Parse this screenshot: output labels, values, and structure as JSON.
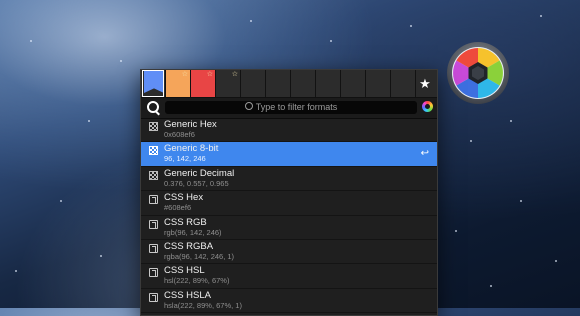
{
  "toolbar": {
    "swatches": [
      {
        "color": "#608ef6",
        "selected": true,
        "starred": false
      },
      {
        "color": "#f5a55a",
        "selected": false,
        "starred": true
      },
      {
        "color": "#e84545",
        "selected": false,
        "starred": true
      },
      {
        "color": "#2c2c2c",
        "selected": false,
        "starred": true
      },
      {
        "color": "#2c2c2c",
        "selected": false,
        "starred": false
      },
      {
        "color": "#2c2c2c",
        "selected": false,
        "starred": false
      },
      {
        "color": "#2c2c2c",
        "selected": false,
        "starred": false
      },
      {
        "color": "#2c2c2c",
        "selected": false,
        "starred": false
      },
      {
        "color": "#2c2c2c",
        "selected": false,
        "starred": false
      },
      {
        "color": "#2c2c2c",
        "selected": false,
        "starred": false
      },
      {
        "color": "#2c2c2c",
        "selected": false,
        "starred": false
      }
    ],
    "favorite_icon": "star-icon",
    "favorite_glyph": "★"
  },
  "search": {
    "placeholder": "Type to filter formats",
    "left_icon": "loupe-icon",
    "right_icon": "color-wheel-icon"
  },
  "formats": [
    {
      "name": "Generic Hex",
      "value": "0x608ef6",
      "icon": "grid-icon",
      "selected": false
    },
    {
      "name": "Generic 8-bit",
      "value": "96, 142, 246",
      "icon": "grid-icon",
      "selected": true
    },
    {
      "name": "Generic Decimal",
      "value": "0.376, 0.557, 0.965",
      "icon": "grid-icon",
      "selected": false
    },
    {
      "name": "CSS Hex",
      "value": "#608ef6",
      "icon": "css-icon",
      "selected": false
    },
    {
      "name": "CSS RGB",
      "value": "rgb(96, 142, 246)",
      "icon": "css-icon",
      "selected": false
    },
    {
      "name": "CSS RGBA",
      "value": "rgba(96, 142, 246, 1)",
      "icon": "css-icon",
      "selected": false
    },
    {
      "name": "CSS HSL",
      "value": "hsl(222, 89%, 67%)",
      "icon": "css-icon",
      "selected": false
    },
    {
      "name": "CSS HSLA",
      "value": "hsla(222, 89%, 67%, 1)",
      "icon": "css-icon",
      "selected": false
    }
  ],
  "selected_action_glyph": "↩",
  "colors": {
    "accent": "#3f87ee",
    "panel": "#1f1f1f"
  }
}
